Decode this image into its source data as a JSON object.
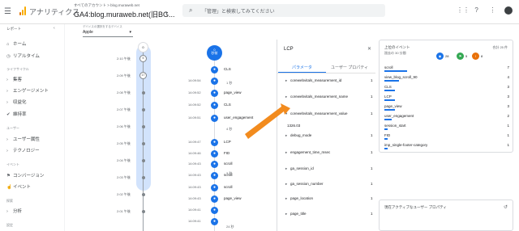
{
  "header": {
    "app_title": "アナリティクス",
    "breadcrumb": "すべてのアカウント > blog.muraweb.net",
    "property": "GA4:blog.muraweb.net(旧BG...",
    "search_placeholder": "「管理」と検索してみてください"
  },
  "stream": {
    "label": "デバイスの選択をするデバイス",
    "value": "Apple"
  },
  "sidebar": {
    "reports_head": "レポート",
    "home": "ホーム",
    "realtime": "リアルタイム",
    "lifecycle": "ライフサイクル",
    "acquisition": "集客",
    "engagement": "エンゲージメント",
    "monetization": "収益化",
    "retention": "維持率",
    "user_section": "ユーザー",
    "user_attrs": "ユーザー属性",
    "tech": "テクノロジー",
    "events_section": "イベント",
    "conversions": "コンバージョン",
    "events": "イベント",
    "explore_section": "探索",
    "analysis": "分析",
    "config_section": "設定"
  },
  "timeline": {
    "top_count": "0",
    "ring_a": "5",
    "ring_b": "17",
    "rows": [
      "2:10 午後",
      "2:09 午後",
      "2:08 午後",
      "2:07 午後",
      "2:06 午後",
      "2:05 午後",
      "2:04 午後",
      "2:03 午後",
      "2:02 午後",
      "2:01 午後"
    ]
  },
  "events": {
    "head_count": "0",
    "head_label": "秒前",
    "items": [
      {
        "time": "",
        "label": "CLS"
      },
      {
        "time": "14:09:54",
        "label": ""
      },
      {
        "time": "14:09:52",
        "label": "page_view"
      },
      {
        "time": "14:09:52",
        "label": "CLS"
      },
      {
        "time": "14:09:51",
        "label": "user_engagement"
      },
      {
        "time": "14:09:47",
        "label": "LCP"
      },
      {
        "time": "14:09:46",
        "label": "FID"
      },
      {
        "time": "14:09:43",
        "label": "scroll"
      },
      {
        "time": "14:09:43",
        "label": "scroll"
      },
      {
        "time": "14:09:43",
        "label": "scroll"
      },
      {
        "time": "14:09:43",
        "label": "page_view"
      },
      {
        "time": "14:09:41",
        "label": ""
      },
      {
        "time": "14:09:41",
        "label": ""
      }
    ],
    "sep_1": "1 秒",
    "sep_4": "4 秒",
    "sep_3": "3 秒",
    "sep_24": "24 秒"
  },
  "panel": {
    "title": "LCP",
    "tab_params": "パラメータ",
    "tab_user": "ユーザー プロパティ",
    "params": [
      {
        "name": "corewebvitals_measurement_id",
        "count": "1",
        "expanded": false
      },
      {
        "name": "corewebvitals_measurement_name",
        "count": "1",
        "expanded": false
      },
      {
        "name": "corewebvitals_measurement_value",
        "count": "1",
        "expanded": true
      },
      {
        "name": "debug_mode",
        "count": "1",
        "expanded": false
      },
      {
        "name": "engagement_time_msec",
        "count": "1",
        "expanded": false
      },
      {
        "name": "ga_session_id",
        "count": "1",
        "expanded": false
      },
      {
        "name": "ga_session_number",
        "count": "1",
        "expanded": false
      },
      {
        "name": "page_location",
        "count": "1",
        "expanded": false
      },
      {
        "name": "page_title",
        "count": "1",
        "expanded": false
      }
    ],
    "expanded_value": "1326.03"
  },
  "top_events": {
    "title": "上位のイベント",
    "subtitle": "過去の 30 分間",
    "total": "合計 25 件",
    "badge_blue": "28",
    "badge_green": "5",
    "badge_orange": "8",
    "items": [
      {
        "label": "scroll",
        "count": "7",
        "fraction": 0.7
      },
      {
        "label": "view_blog_scroll_90",
        "count": "4",
        "fraction": 0.45
      },
      {
        "label": "CLS",
        "count": "3",
        "fraction": 0.33
      },
      {
        "label": "LCP",
        "count": "3",
        "fraction": 0.33
      },
      {
        "label": "page_view",
        "count": "3",
        "fraction": 0.33
      },
      {
        "label": "user_engagement",
        "count": "2",
        "fraction": 0.22
      },
      {
        "label": "session_start",
        "count": "1",
        "fraction": 0.11
      },
      {
        "label": "FID",
        "count": "1",
        "fraction": 0.11
      },
      {
        "label": "imp_single-footer-category",
        "count": "1",
        "fraction": 0.11
      }
    ]
  },
  "user_props": {
    "title": "現在アクティブなユーザー プロパティ"
  },
  "colors": {
    "accent": "#1a73e8",
    "arrow": "#f28b1e",
    "green": "#34a853",
    "orange": "#e8710a"
  }
}
